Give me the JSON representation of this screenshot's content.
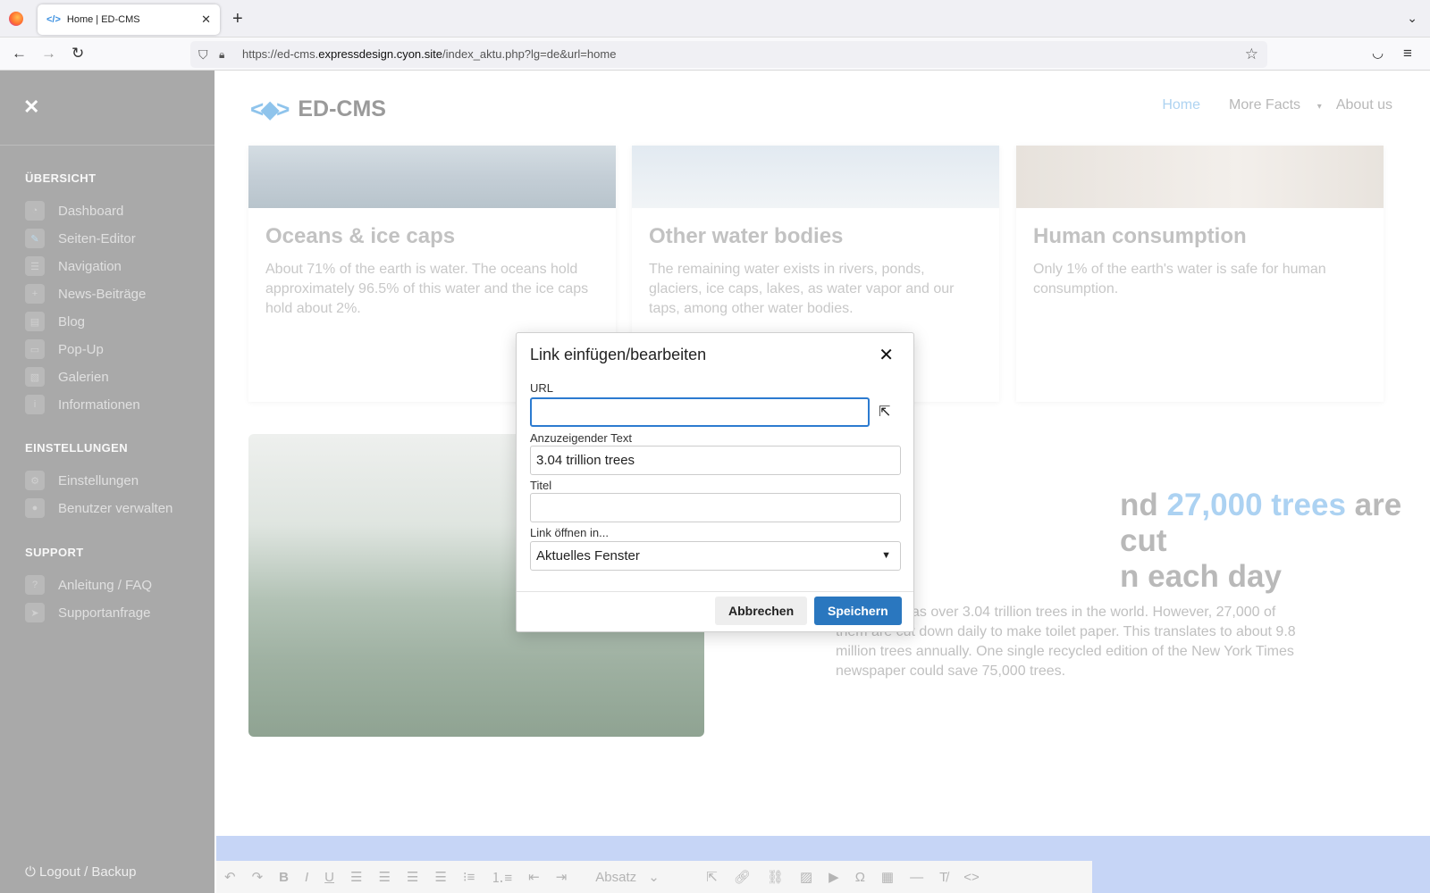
{
  "browser": {
    "tab_title": "Home |  ED-CMS",
    "tab_favicon": "</>",
    "new_tab": "+",
    "url_prefix": "https://ed-cms.",
    "url_domain": "expressdesign.cyon.site",
    "url_path": "/index_aktu.php?lg=de&url=home"
  },
  "sidebar": {
    "close": "✕",
    "sections": [
      {
        "heading": "ÜBERSICHT",
        "items": [
          "Dashboard",
          "Seiten-Editor",
          "Navigation",
          "News-Beiträge",
          "Blog",
          "Pop-Up",
          "Galerien",
          "Informationen"
        ]
      },
      {
        "heading": "EINSTELLUNGEN",
        "items": [
          "Einstellungen",
          "Benutzer verwalten"
        ]
      },
      {
        "heading": "SUPPORT",
        "items": [
          "Anleitung / FAQ",
          "Supportanfrage"
        ]
      }
    ],
    "logout": "Logout / Backup"
  },
  "site": {
    "brand": "ED-CMS",
    "nav": [
      "Home",
      "More Facts",
      "About us"
    ],
    "cards": [
      {
        "title": "Oceans & ice caps",
        "text": "About 71% of the earth is water. The oceans hold approximately 96.5% of this water and the ice caps hold about 2%."
      },
      {
        "title": "Other water bodies",
        "text": "The remaining water exists in rivers, ponds, glaciers, ice caps, lakes, as water vapor and our taps, among other water bodies."
      },
      {
        "title": "Human consumption",
        "text": "Only 1% of the earth's water is safe for human consumption."
      }
    ],
    "headline_pre": "nd ",
    "headline_hl": "27,000 trees",
    "headline_post": " are cut",
    "headline_line2": "n each day",
    "body_l1": "as over 3.04 trillion trees in the world. However, 27,000 of",
    "body_l2": "them are cut down daily to make toilet paper. This translates to about 9.8",
    "body_l3": "million trees annually. One single recycled edition of the New York Times",
    "body_l4": "newspaper could save 75,000 trees."
  },
  "editor": {
    "format_select": "Absatz"
  },
  "dialog": {
    "title": "Link einfügen/bearbeiten",
    "url_label": "URL",
    "url_value": "",
    "text_label": "Anzuzeigender Text",
    "text_value": "3.04 trillion trees",
    "title_label": "Titel",
    "title_value": "",
    "target_label": "Link öffnen in...",
    "target_value": "Aktuelles Fenster",
    "cancel": "Abbrechen",
    "save": "Speichern"
  }
}
